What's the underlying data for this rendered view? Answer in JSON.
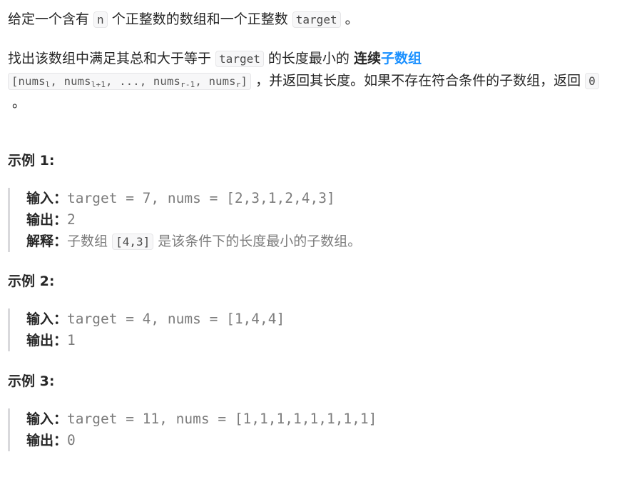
{
  "description": {
    "p1": {
      "t1": "给定一个含有 ",
      "code_n": "n",
      "t2": " 个正整数的数组和一个正整数 ",
      "code_target": "target",
      "t3": " 。"
    },
    "p2": {
      "t1": "找出该数组中满足其总和大于等于 ",
      "code_target": "target",
      "t2": " 的长度最小的 ",
      "bold": "连续",
      "link": "子数组",
      "range": {
        "open": "[nums",
        "sub_l": "l",
        "sep1": ", nums",
        "sub_l1": "l+1",
        "mid": ", ..., nums",
        "sub_r1": "r-1",
        "sep2": ", nums",
        "sub_r": "r",
        "close": "]"
      },
      "t3": " ，并返回其长度。如果不存在符合条件的子数组，返回 ",
      "code_zero": "0",
      "t4": " 。"
    }
  },
  "examples": [
    {
      "title": "示例 1:",
      "input_label": "输入：",
      "input_value": "target = 7, nums = [2,3,1,2,4,3]",
      "output_label": "输出：",
      "output_value": "2",
      "explain_label": "解释：",
      "explain_pre": "子数组 ",
      "explain_code": "[4,3]",
      "explain_post": " 是该条件下的长度最小的子数组。"
    },
    {
      "title": "示例 2:",
      "input_label": "输入：",
      "input_value": "target = 4, nums = [1,4,4]",
      "output_label": "输出：",
      "output_value": "1"
    },
    {
      "title": "示例 3:",
      "input_label": "输入：",
      "input_value": "target = 11, nums = [1,1,1,1,1,1,1,1]",
      "output_label": "输出：",
      "output_value": "0"
    }
  ]
}
